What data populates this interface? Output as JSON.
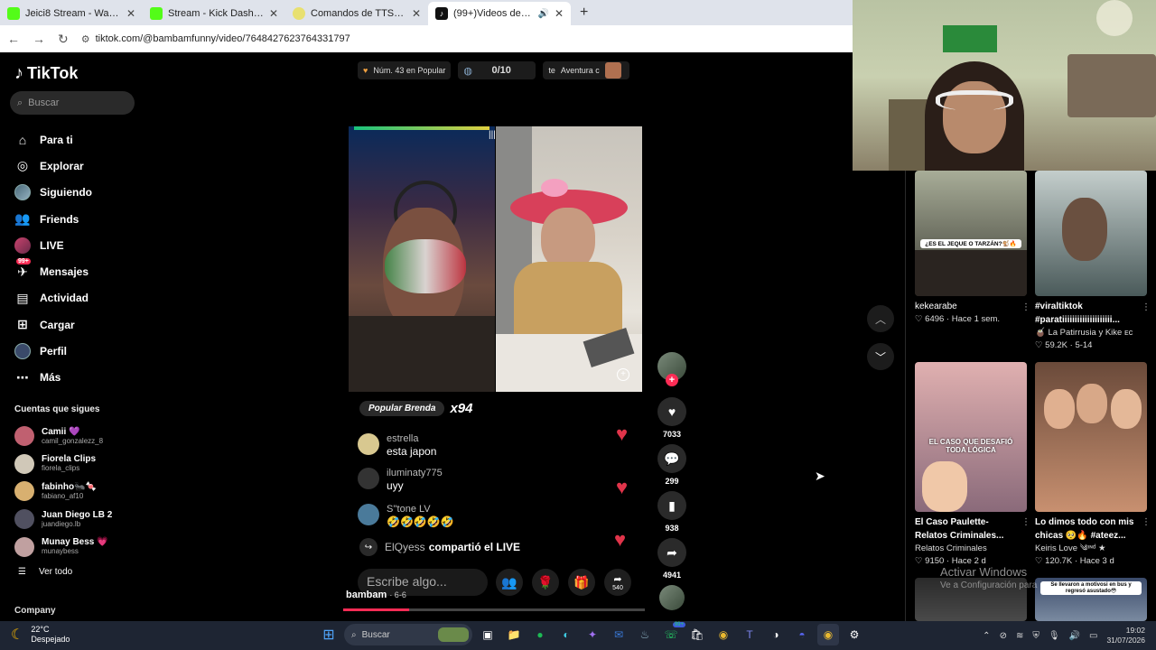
{
  "browser": {
    "tabs": [
      {
        "title": "Jeici8 Stream - Watch Live on K",
        "fav_color": "#53fc18",
        "active": false
      },
      {
        "title": "Stream - Kick Dashboard",
        "fav_color": "#53fc18",
        "active": false
      },
      {
        "title": "Comandos de TTS de KickBot",
        "fav_color": "#e8e070",
        "active": false
      },
      {
        "title": "(99+)Videos de bambam (@",
        "fav_color": "#111111",
        "active": true
      }
    ],
    "url": "tiktok.com/@bambamfunny/video/7648427623764331797"
  },
  "tiktok": {
    "logo": "TikTok",
    "search_placeholder": "Buscar",
    "nav": [
      {
        "label": "Para ti",
        "icon": "home-icon"
      },
      {
        "label": "Explorar",
        "icon": "compass-icon"
      },
      {
        "label": "Siguiendo",
        "icon": "avatar-icon"
      },
      {
        "label": "Friends",
        "icon": "friends-icon"
      },
      {
        "label": "LIVE",
        "icon": "live-icon"
      },
      {
        "label": "Mensajes",
        "icon": "messages-icon",
        "badge": "99+"
      },
      {
        "label": "Actividad",
        "icon": "activity-icon"
      },
      {
        "label": "Cargar",
        "icon": "upload-icon"
      },
      {
        "label": "Perfil",
        "icon": "profile-icon"
      },
      {
        "label": "Más",
        "icon": "more-icon"
      }
    ],
    "following_header": "Cuentas que sigues",
    "following": [
      {
        "name": "Camii 💜",
        "user": "camil_gonzalezz_8",
        "color": "#c06070"
      },
      {
        "name": "Fiorela Clips",
        "user": "fiorela_clips",
        "color": "#d0c8b8"
      },
      {
        "name": "fabinho🐜🍬",
        "user": "fabiano_af10",
        "color": "#d8b070"
      },
      {
        "name": "Juan Diego LB 2",
        "user": "juandiego.lb",
        "color": "#505060"
      },
      {
        "name": "Munay Bess 💗",
        "user": "munaybess",
        "color": "#c0a0a0"
      }
    ],
    "see_all": "Ver todo",
    "company": "Company"
  },
  "video": {
    "chips": {
      "rank": "Núm. 43 en Popular",
      "score": "0/10",
      "adventure_prefix": "te",
      "adventure": "Aventura c"
    },
    "popular_label": "Popular Brenda",
    "multiplier": "x94",
    "messages": [
      {
        "user": "estrella",
        "text": "esta japon",
        "color": "#d8c890"
      },
      {
        "user": "iluminaty775",
        "text": "uyy",
        "color": "#333333"
      },
      {
        "user": "S''tone LV",
        "text": "🤣🤣🤣🤣🤣",
        "color": "#4a7a9a"
      }
    ],
    "shared_user": "ElQyess",
    "shared_text": "compartió el LIVE",
    "composer_placeholder": "Escribe algo...",
    "gift_count": "540",
    "author": "bambam",
    "author_age": "· 6-6",
    "progress": 0.22,
    "actions": {
      "likes": "7033",
      "comments": "299",
      "saves": "938",
      "shares": "4941"
    }
  },
  "related": [
    {
      "title": "kekearabe",
      "sub": "",
      "likes": "6496",
      "time": "Hace 1 sem.",
      "overlay": "¿ES EL JEQUE O TARZÁN?🐒🔥",
      "colors": [
        "#8a8f7a",
        "#3a3a32"
      ]
    },
    {
      "title": "#viraltiktok",
      "sub": "#paratiiiiiiiiiiiiiiiiiiii...",
      "author": "🧉 La Patirrusia y Kike ᴇᴄ",
      "likes": "59.2K",
      "time": "5-14",
      "colors": [
        "#b8c4c4",
        "#4a5a5a"
      ]
    },
    {
      "title": "El Caso Paulette-",
      "sub": "Relatos Criminales...",
      "author": "Relatos Criminales",
      "likes": "9150",
      "time": "Hace 2 d",
      "overlay": "EL CASO QUE DESAFIÓ TODA LÓGICA",
      "colors": [
        "#d9a6a6",
        "#7a5a6a"
      ]
    },
    {
      "title": "Lo dimos todo con mis",
      "sub": "chicas 🥺🔥 #ateez...",
      "author": "Keiris Love ༄ᶦᶰᵈ ★",
      "likes": "120.7K",
      "time": "Hace 3 d",
      "colors": [
        "#6a4a3a",
        "#e0b090"
      ]
    },
    {
      "overlay": "Se llevaron a motivosi en bus y regresó asustado😳",
      "colors": [
        "#3a4a6a",
        "#7a8aa0"
      ]
    }
  ],
  "watermark": {
    "line1": "Activar Windows",
    "line2": "Ve a Configuración para"
  },
  "taskbar": {
    "weather_temp": "22°C",
    "weather_desc": "Despejado",
    "search": "Buscar",
    "time": "19:02",
    "date": "31/07/2026"
  }
}
